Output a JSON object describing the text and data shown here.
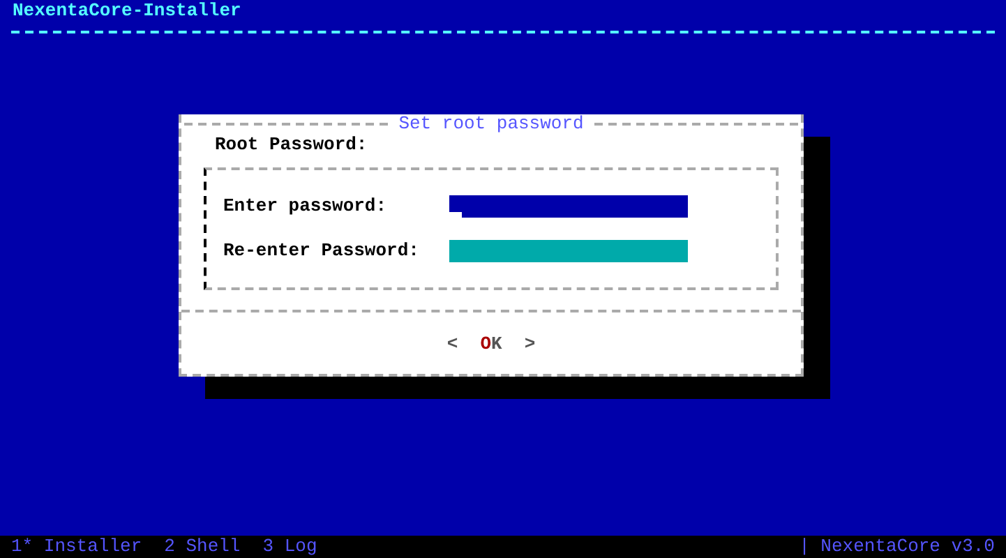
{
  "window": {
    "title": "NexentaCore-Installer"
  },
  "dialog": {
    "title": "Set root password",
    "section_label": "Root Password:",
    "fields": [
      {
        "label": "Enter password:",
        "focused": true
      },
      {
        "label": "Re-enter Password:",
        "focused": false
      }
    ],
    "buttons": [
      {
        "open": "<",
        "label": "OK",
        "close": ">"
      }
    ]
  },
  "status_bar": {
    "screens": [
      "1* Installer",
      "2 Shell",
      "3 Log"
    ],
    "separator": "|",
    "right": "NexentaCore v3.0"
  }
}
